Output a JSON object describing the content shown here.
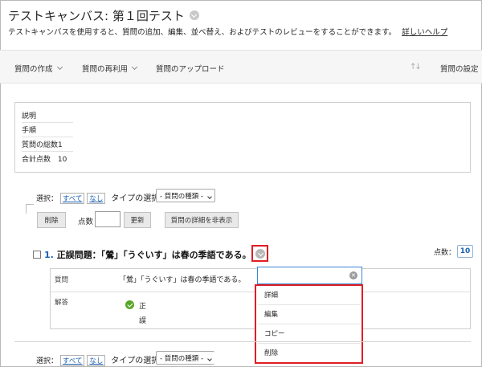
{
  "header": {
    "title": "テストキャンバス: 第１回テスト",
    "description": "テストキャンバスを使用すると、質問の追加、編集、並べ替え、およびテストのレビューをすることができます。",
    "help_link": "詳しいヘルプ"
  },
  "toolbar": {
    "create_question": "質問の作成",
    "reuse_question": "質問の再利用",
    "upload_questions": "質問のアップロード",
    "question_settings": "質問の設定"
  },
  "info": {
    "description_label": "説明",
    "instructions_label": "手順",
    "total_questions": "質問の総数1",
    "total_points_label": "合計点数",
    "total_points_value": "10"
  },
  "controls": {
    "select_label": "選択：",
    "select_all": "すべて",
    "select_none": "なし",
    "type_select_label": "タイプの選択：",
    "type_select_value": "- 質問の種類 -",
    "delete_button": "削除",
    "points_label": "点数",
    "update_button": "更新",
    "hide_details_button": "質問の詳細を非表示"
  },
  "question": {
    "number": "1.",
    "title": "正誤問題：「鶯」「うぐいす」は春の季語である。",
    "points_label": "点数：",
    "points_value": "10",
    "question_label": "質問",
    "question_text": "「鶯」「うぐいす」は春の季語である。",
    "answer_label": "解答",
    "answer_true": "正",
    "answer_false": "誤"
  },
  "menu": {
    "clear_glyph": "×",
    "items": [
      "詳細",
      "編集",
      "コピー",
      "削除"
    ]
  },
  "colors": {
    "highlight": "#e01e24",
    "link": "#1a5fb4",
    "correct": "#58a62a",
    "toolbar_bg": "#f6f6f6"
  }
}
